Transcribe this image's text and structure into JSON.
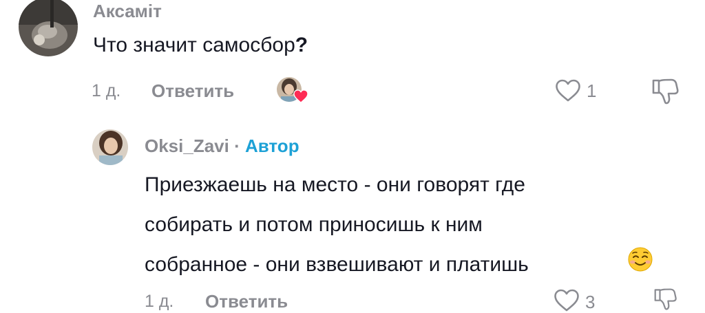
{
  "comment": {
    "username": "Аксаміт",
    "text": "Что значит самосбор",
    "text_mark": "?",
    "time": "1 д.",
    "reply_label": "Ответить",
    "likes": "1",
    "liked_by_author_avatar": "creator-avatar-with-heart",
    "reply": {
      "username": "Oksi_Zavi",
      "separator": "·",
      "author_badge": "Автор",
      "lines": [
        "Приезжаешь на место - они говорят где",
        "собирать и потом приносишь к ним",
        "собранное - они взвешивают и платишь"
      ],
      "emoji": "☺",
      "time": "1 д.",
      "reply_label": "Ответить",
      "likes": "3"
    }
  },
  "colors": {
    "secondary_text": "#8a8b91",
    "author_badge": "#1da1d6",
    "heart": "#fe2c55"
  }
}
